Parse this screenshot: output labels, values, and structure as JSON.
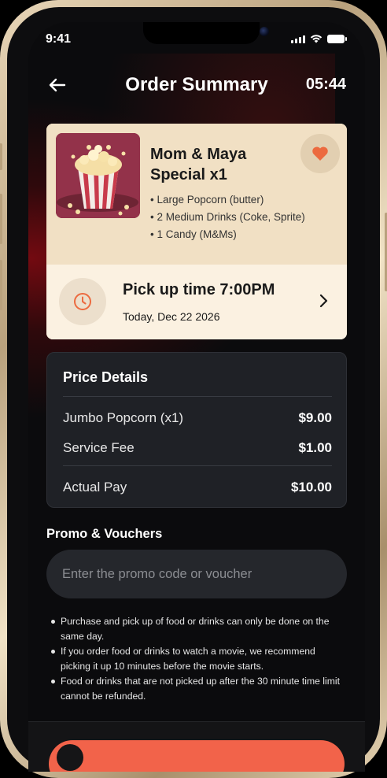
{
  "status_bar": {
    "time": "9:41"
  },
  "header": {
    "title": "Order Summary",
    "timer": "05:44"
  },
  "order": {
    "combo_title": "Mom & Maya Special  x1",
    "items": [
      "Large Popcorn (butter)",
      "2 Medium Drinks (Coke, Sprite)",
      "1 Candy (M&Ms)"
    ],
    "pickup_title": "Pick up time 7:00PM",
    "pickup_date": "Today, Dec 22 2026"
  },
  "price_details": {
    "title": "Price Details",
    "rows": [
      {
        "label": "Jumbo Popcorn (x1)",
        "amount": "$9.00"
      },
      {
        "label": "Service Fee",
        "amount": "$1.00"
      }
    ],
    "total": {
      "label": "Actual Pay",
      "amount": "$10.00"
    }
  },
  "promo": {
    "label": "Promo & Vouchers",
    "placeholder": "Enter the promo code or voucher"
  },
  "notes": [
    "Purchase and pick up of food or drinks can only be done on the same day.",
    "If you order food or drinks to watch a movie, we recommend picking it up 10 minutes before the movie starts.",
    "Food or drinks that are not picked up after the 30 minute time limit cannot be refunded."
  ],
  "colors": {
    "accent": "#f2634a",
    "card_bg": "#f1e0c4",
    "pickup_bg": "#fbf1e1",
    "dark_card": "#1f2126",
    "heart": "#ec6a3f"
  }
}
